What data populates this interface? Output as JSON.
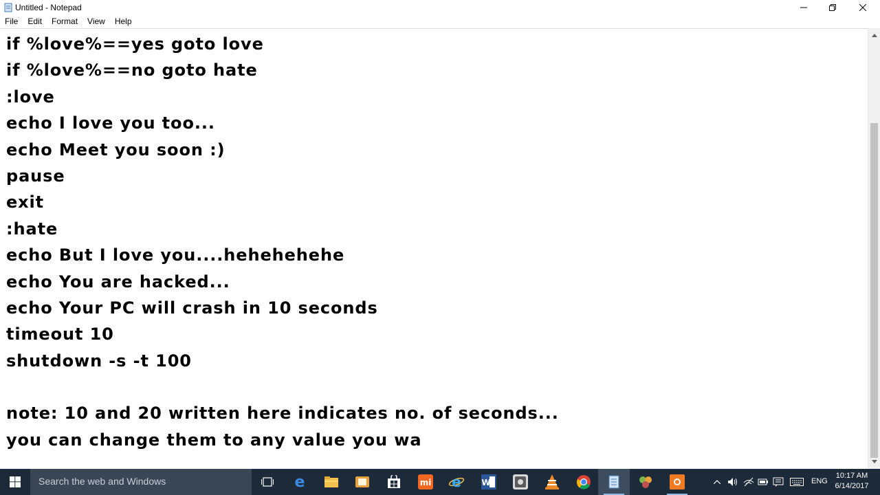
{
  "window": {
    "title": "Untitled - Notepad",
    "icons": {
      "app": "notepad-icon",
      "minimize": "minimize-icon",
      "maximize": "restore-icon",
      "close": "close-icon"
    }
  },
  "menu": [
    "File",
    "Edit",
    "Format",
    "View",
    "Help"
  ],
  "editor": {
    "lines": [
      "if %love%==yes goto love",
      "if %love%==no goto hate",
      ":love",
      "echo I love you too...",
      "echo Meet you soon :)",
      "pause",
      "exit",
      ":hate",
      "echo But I love you....hehehehehe",
      "echo You are hacked...",
      "echo Your PC will crash in 10 seconds",
      "timeout 10",
      "shutdown -s -t 100",
      "",
      "note: 10 and 20 written here indicates no. of seconds...",
      "you can change them to any value you wa"
    ]
  },
  "taskbar": {
    "search_placeholder": "Search the web and Windows",
    "apps": [
      "task-view-icon",
      "edge-icon",
      "file-explorer-icon",
      "media-app-icon",
      "store-icon",
      "mi-icon",
      "internet-explorer-icon",
      "word-icon",
      "finder-app-icon",
      "vlc-icon",
      "chrome-icon",
      "notepad-icon",
      "app-icon",
      "recorder-icon"
    ],
    "tray": {
      "language": "ENG",
      "time": "10:17 AM",
      "date": "6/14/2017"
    }
  },
  "colors": {
    "taskbar": "#1c2a3a",
    "search_box": "#3a4655",
    "accent": "#8fb8e3"
  }
}
